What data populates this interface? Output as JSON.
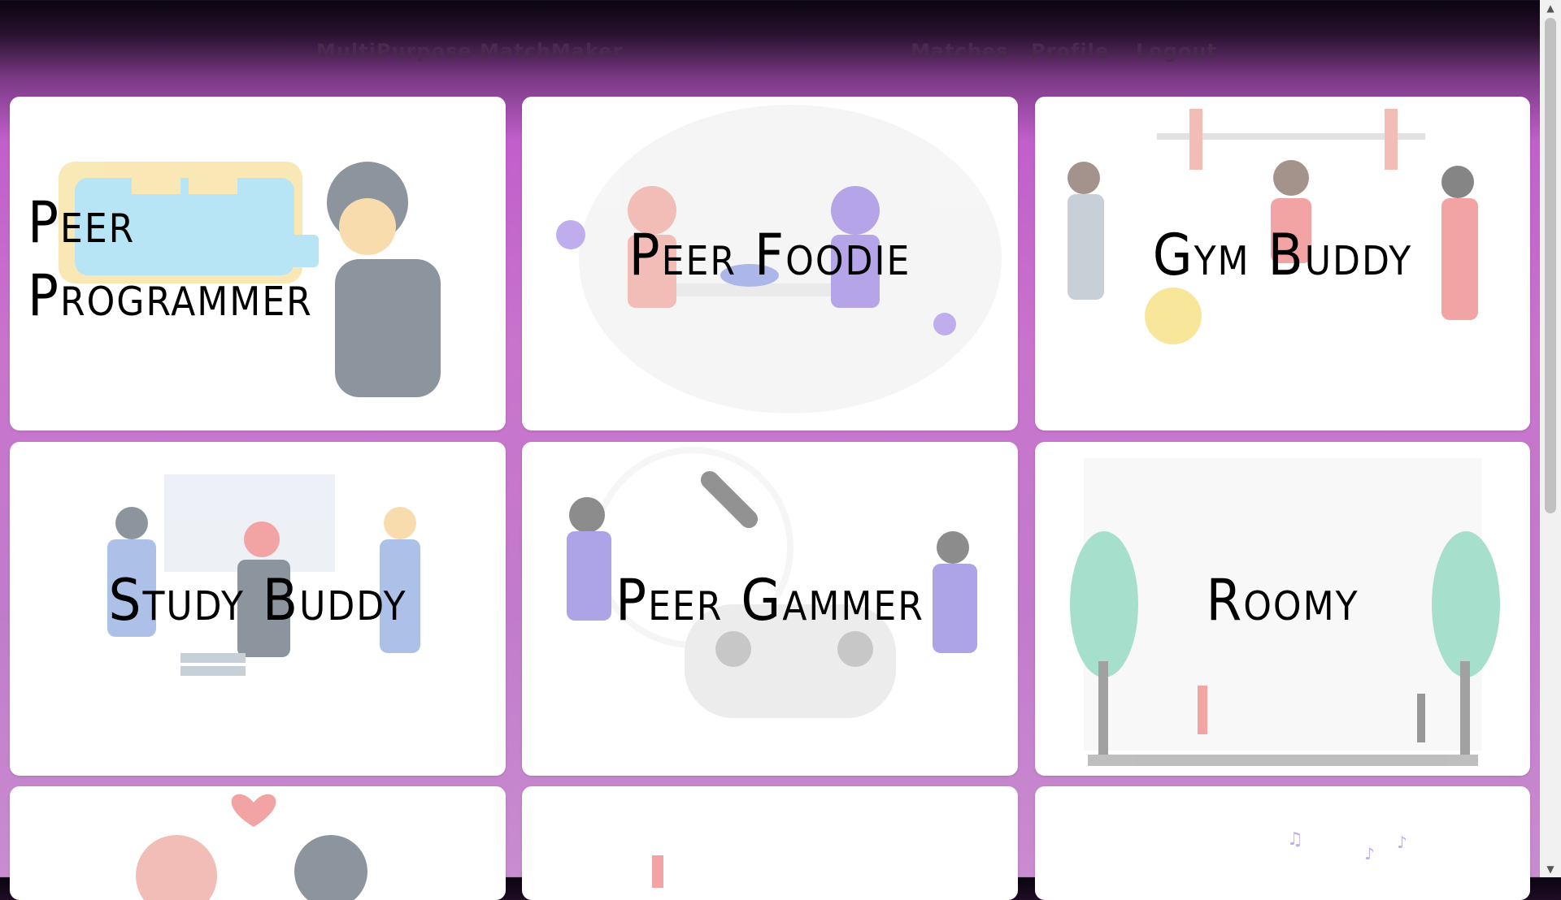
{
  "navbar": {
    "brand": "MultiPurpose MatchMaker",
    "links": [
      "Matches",
      "Profile",
      "Logout"
    ]
  },
  "cards": [
    {
      "title_lines": [
        "Peer",
        "Programmer"
      ]
    },
    {
      "title": "Peer Foodie"
    },
    {
      "title": "Gym Buddy"
    },
    {
      "title": "Study Buddy"
    },
    {
      "title": "Peer Gammer"
    },
    {
      "title": "Roomy"
    }
  ],
  "colors": {
    "accent": "#c15fcb",
    "nav_text": "#4a2a4e"
  }
}
